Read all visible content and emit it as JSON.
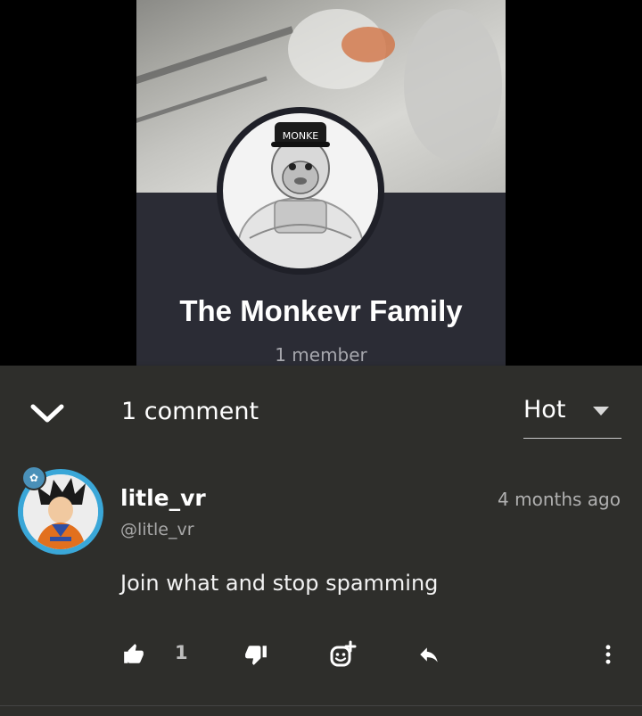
{
  "group": {
    "name": "The Monkevr Family",
    "members": "1 member",
    "cap_text": "MONKE"
  },
  "comments_header": {
    "count_label": "1 comment",
    "sort": {
      "selected": "Hot"
    }
  },
  "comment": {
    "username": "litle_vr",
    "handle": "@litle_vr",
    "timestamp": "4 months ago",
    "text": "Join what and stop spamming",
    "like_count": "1"
  },
  "icons": {
    "collapse": "chevron-down-icon",
    "like": "thumbs-up-icon",
    "dislike": "thumbs-down-icon",
    "react": "add-reaction-icon",
    "reply": "reply-icon",
    "more": "more-vertical-icon"
  },
  "colors": {
    "panel": "#2e2e2b",
    "card": "#2b2c35",
    "avatar_ring": "#3aa7d8"
  }
}
